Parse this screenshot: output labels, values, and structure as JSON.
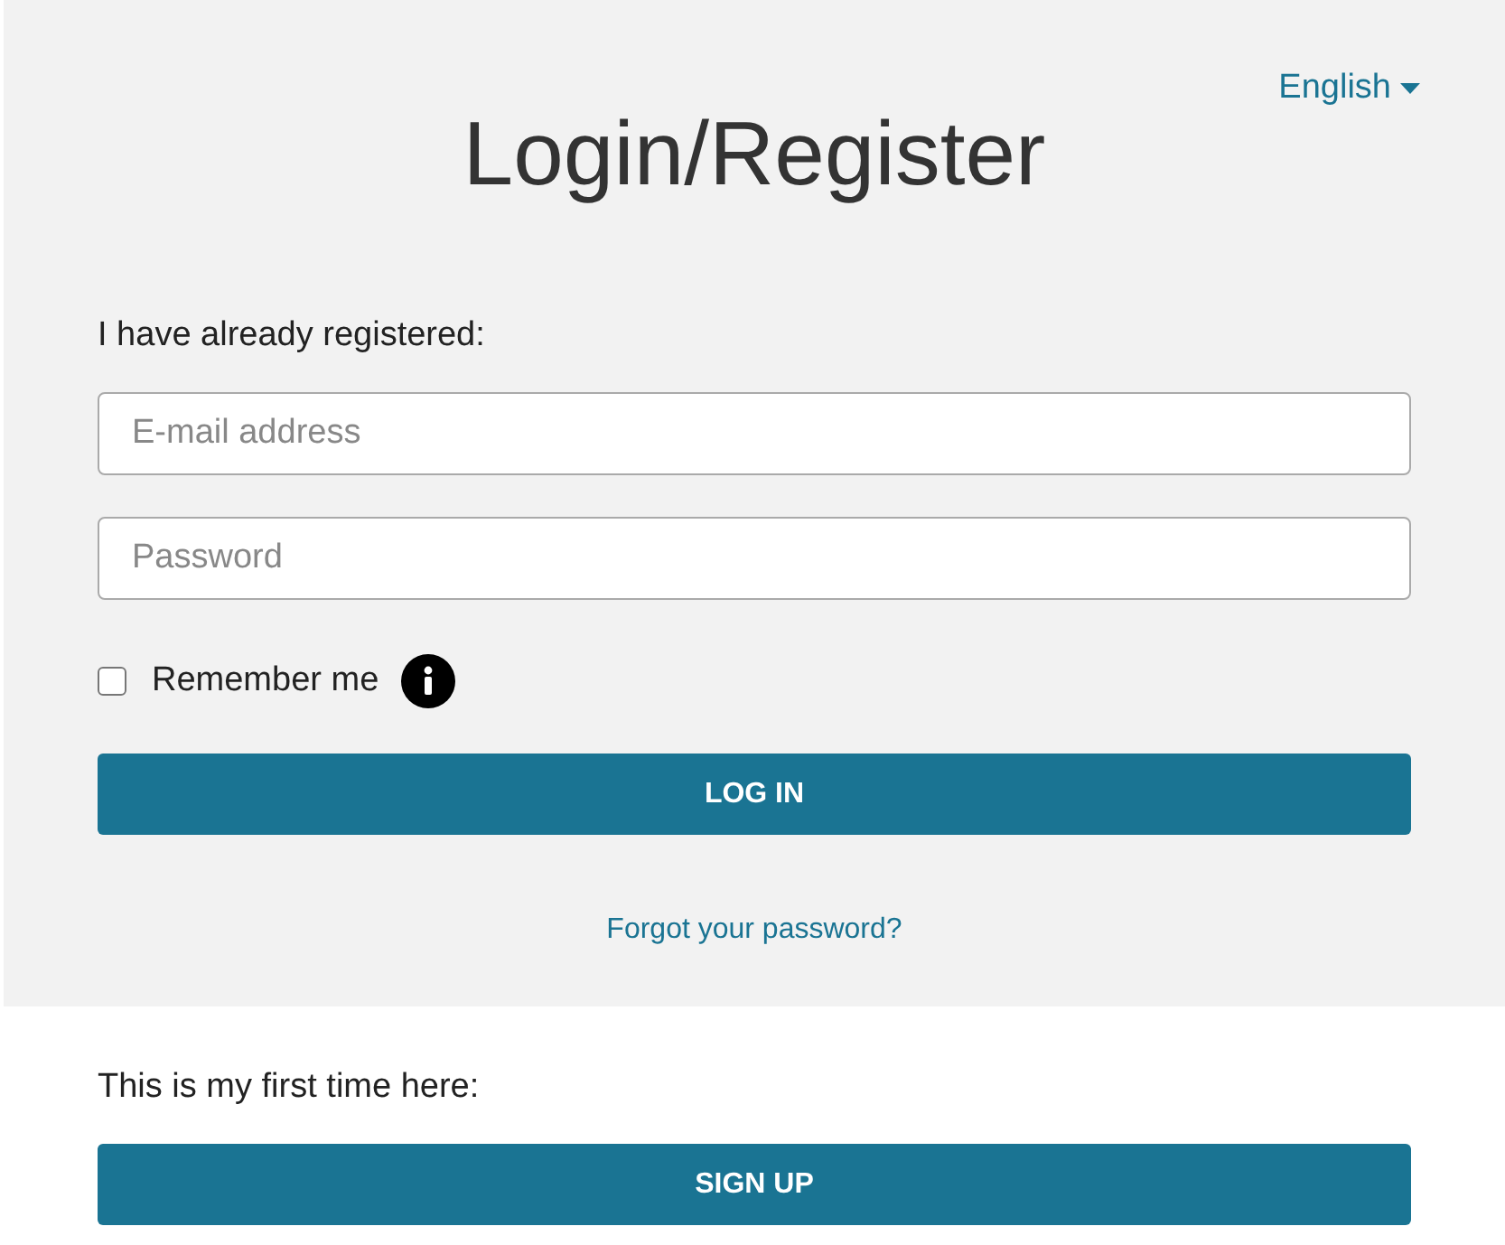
{
  "language": {
    "label": "English"
  },
  "title": "Login/Register",
  "login": {
    "heading": "I have already registered:",
    "email": {
      "placeholder": "E-mail address"
    },
    "password": {
      "placeholder": "Password"
    },
    "remember": {
      "label": "Remember me",
      "checked": false
    },
    "button": "LOG IN",
    "forgot": "Forgot your password?"
  },
  "register": {
    "heading": "This is my first time here:",
    "button": "SIGN UP"
  }
}
